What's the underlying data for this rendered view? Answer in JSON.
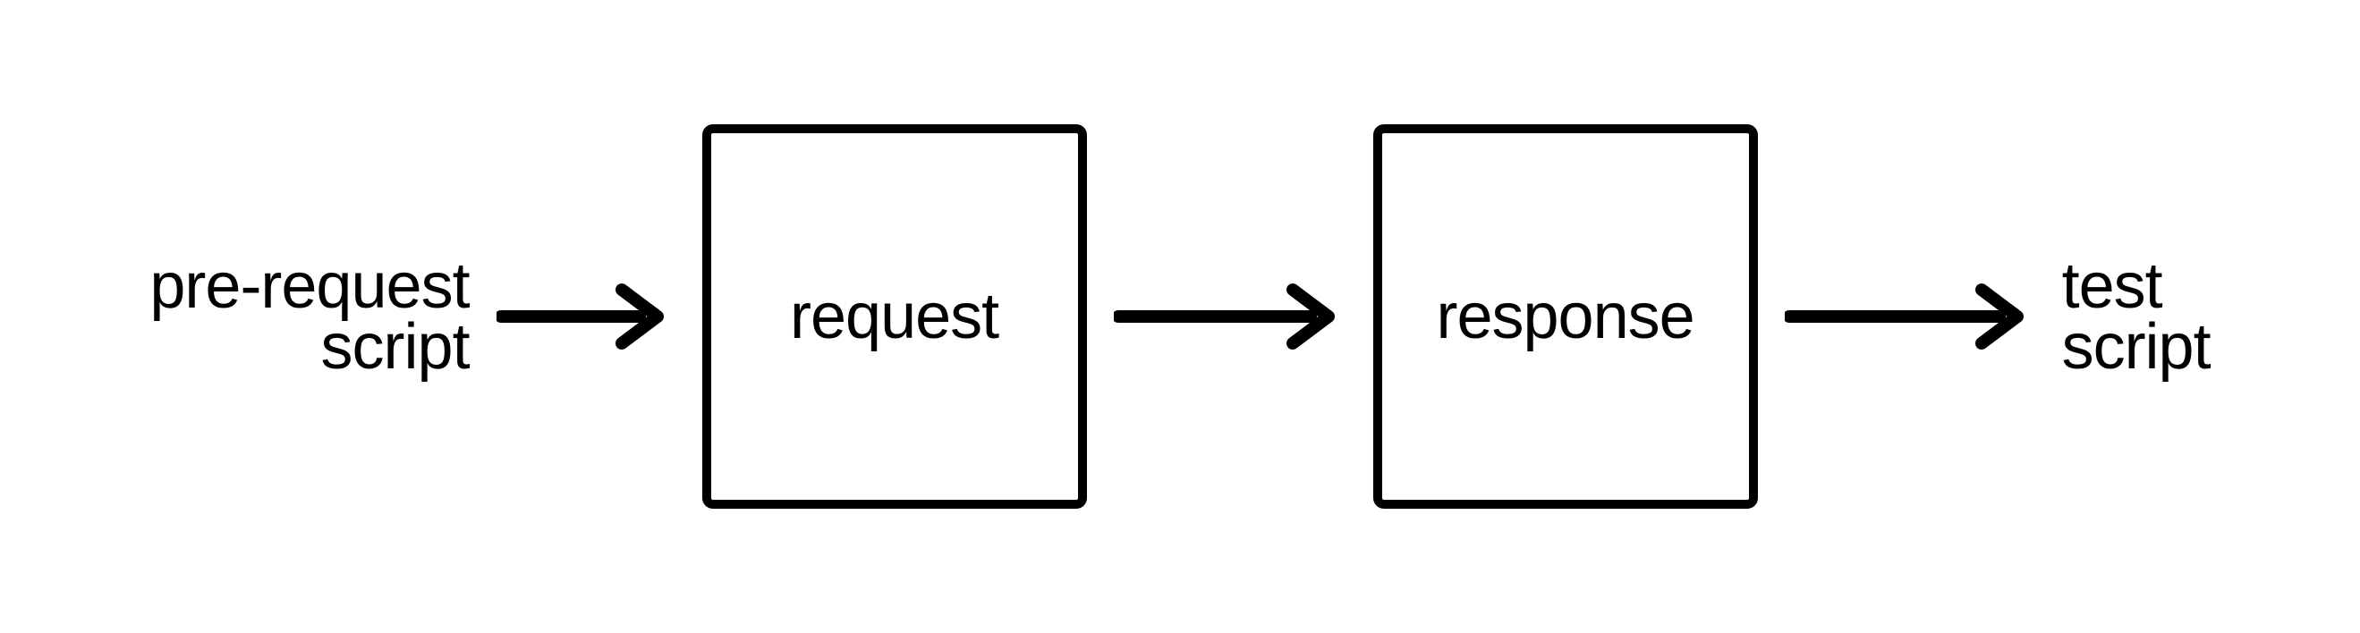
{
  "diagram": {
    "leftLabel": {
      "line1": "pre-request",
      "line2": "script"
    },
    "box1": "request",
    "box2": "response",
    "rightLabel": {
      "line1": "test",
      "line2": "script"
    }
  }
}
